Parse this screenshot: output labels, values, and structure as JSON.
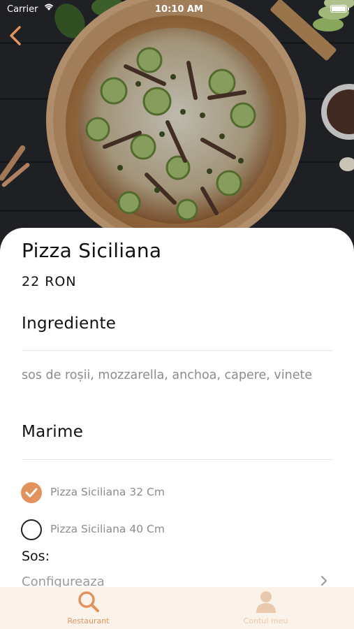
{
  "status_bar": {
    "carrier": "Carrier",
    "time": "10:10 AM"
  },
  "product": {
    "name": "Pizza Siciliana",
    "price": "22 RON",
    "image_icon": "pizza-photo"
  },
  "ingredients": {
    "heading": "Ingrediente",
    "text": "sos de roșii, mozzarella, anchoa, capere, vinete"
  },
  "size": {
    "heading": "Marime",
    "options": [
      {
        "label": "Pizza Siciliana 32 Cm",
        "selected": true
      },
      {
        "label": "Pizza Siciliana 40 Cm",
        "selected": false
      }
    ]
  },
  "sauce": {
    "label": "Sos:",
    "configure_label": "Configureaza"
  },
  "tabs": [
    {
      "label": "Restaurant",
      "icon": "search-icon",
      "active": true
    },
    {
      "label": "Contul meu",
      "icon": "user-icon",
      "active": false
    }
  ],
  "colors": {
    "accent": "#e2935d",
    "tabbar_bg": "#fbf3ea",
    "inactive_tab": "#e8c9ad"
  }
}
